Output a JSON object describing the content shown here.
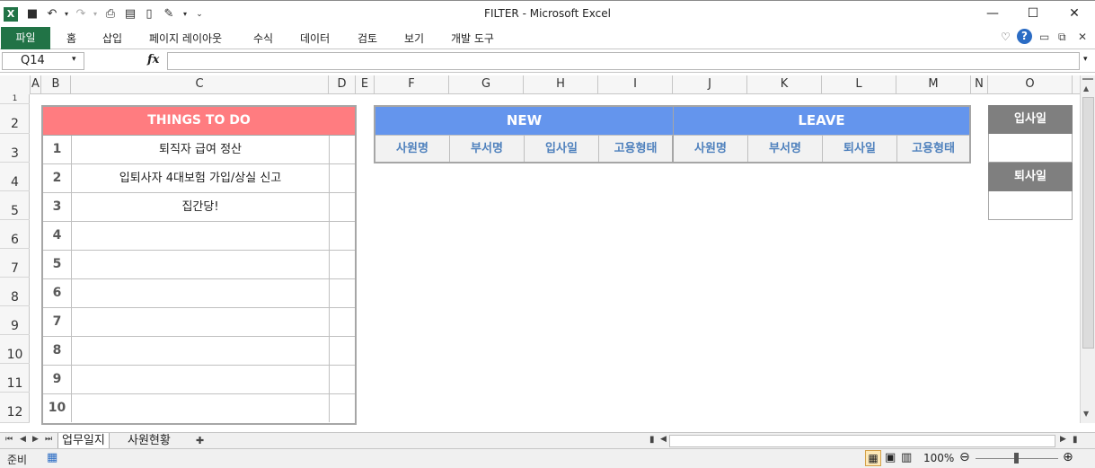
{
  "window": {
    "title": "FILTER  -  Microsoft Excel",
    "minimize": "—",
    "maximize": "☐",
    "close": "✕"
  },
  "ribbon": {
    "file_tab": "파일",
    "tabs": [
      "홈",
      "삽입",
      "페이지 레이아웃",
      "수식",
      "데이터",
      "검토",
      "보기",
      "개발 도구"
    ]
  },
  "formula_bar": {
    "name_box": "Q14",
    "fx": "fx",
    "formula": ""
  },
  "columns": [
    "A",
    "B",
    "C",
    "D",
    "E",
    "F",
    "G",
    "H",
    "I",
    "J",
    "K",
    "L",
    "M",
    "N",
    "O"
  ],
  "rows": [
    "2",
    "3",
    "4",
    "5",
    "6",
    "7",
    "8",
    "9",
    "10",
    "11",
    "12"
  ],
  "todo": {
    "title": "THINGS TO DO",
    "items": [
      {
        "num": "1",
        "text": "퇴직자 급여 정산"
      },
      {
        "num": "2",
        "text": "입퇴사자 4대보험 가입/상실 신고"
      },
      {
        "num": "3",
        "text": "집간당!"
      },
      {
        "num": "4",
        "text": ""
      },
      {
        "num": "5",
        "text": ""
      },
      {
        "num": "6",
        "text": ""
      },
      {
        "num": "7",
        "text": ""
      },
      {
        "num": "8",
        "text": ""
      },
      {
        "num": "9",
        "text": ""
      },
      {
        "num": "10",
        "text": ""
      }
    ]
  },
  "new_leave": {
    "new_title": "NEW",
    "leave_title": "LEAVE",
    "new_cols": [
      "사원명",
      "부서명",
      "입사일",
      "고용형태"
    ],
    "leave_cols": [
      "사원명",
      "부서명",
      "퇴사일",
      "고용형태"
    ]
  },
  "dates": {
    "join_label": "입사일",
    "leave_label": "퇴사일"
  },
  "sheets": {
    "active": "업무일지",
    "other": "사원현황"
  },
  "status": {
    "ready": "준비",
    "zoom": "100%"
  },
  "colors": {
    "excel_green": "#217346",
    "todo_header": "#ff7c80",
    "blue_header": "#6495ed",
    "gray_header": "#7f7f7f"
  }
}
